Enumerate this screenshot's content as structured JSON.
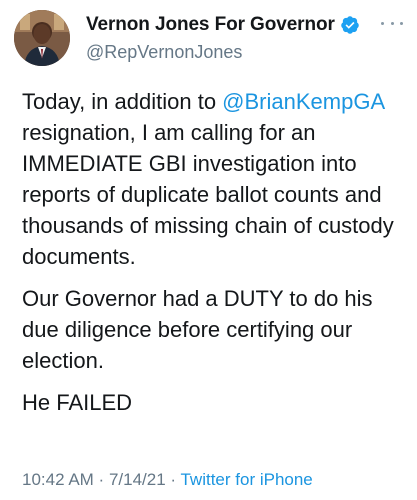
{
  "tweet": {
    "author": {
      "display_name": "Vernon Jones For Governor",
      "handle": "@RepVernonJones",
      "verified": true
    },
    "text": {
      "p1_before": "Today, in addition to ",
      "mention": "@BrianKempGA",
      "p1_after": " resignation, I am calling for an IMMEDIATE GBI investigation into reports of duplicate ballot counts and thousands of missing chain of custody documents.",
      "p2": "Our Governor had a DUTY to do his due diligence before certifying our election.",
      "p3": "He FAILED"
    },
    "meta": {
      "time": "10:42 AM",
      "sep1": " · ",
      "date": "7/14/21",
      "sep2": " · ",
      "source": "Twitter for iPhone"
    }
  },
  "colors": {
    "link": "#1b95e0",
    "secondary": "#657786",
    "verified_badge": "#1da1f2"
  },
  "icons": {
    "verified": "verified-badge-icon",
    "more": "more-horizontal-icon"
  }
}
